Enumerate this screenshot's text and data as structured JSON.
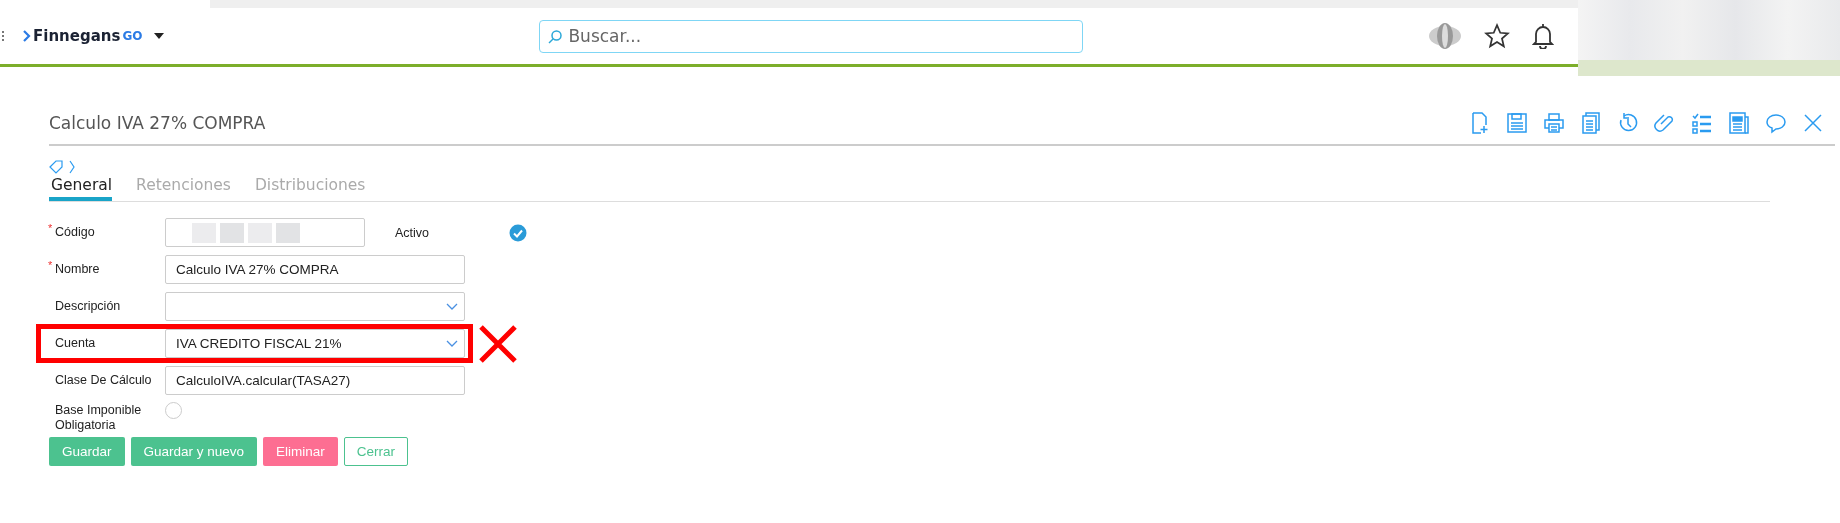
{
  "header": {
    "logo": {
      "name": "Finnegans",
      "suffix": "GO"
    },
    "search": {
      "placeholder": "Buscar..."
    }
  },
  "form": {
    "title": "Calculo IVA 27% COMPRA",
    "tabs": [
      {
        "label": "General",
        "selected": true
      },
      {
        "label": "Retenciones",
        "selected": false
      },
      {
        "label": "Distribuciones",
        "selected": false
      }
    ],
    "fields": [
      {
        "kind": "text",
        "label": "Código",
        "required_mark": "*",
        "blurred": true,
        "annotated": false,
        "side": {
          "label": "Activo",
          "checked": true
        }
      },
      {
        "kind": "text",
        "label": "Nombre",
        "required_mark": "*",
        "value": "Calculo IVA 27% COMPRA",
        "annotated": false
      },
      {
        "kind": "select",
        "label": "Descripción",
        "annotated": false
      },
      {
        "kind": "select",
        "label": "Cuenta",
        "value": "IVA CREDITO FISCAL 21%",
        "annotated": true
      },
      {
        "kind": "text",
        "label": "Clase De Cálculo",
        "value": "CalculoIVA.calcular(TASA27)",
        "annotated": false
      },
      {
        "kind": "radio",
        "label": "Base Imponible Obligatoria",
        "checked": false,
        "annotated": false
      }
    ],
    "buttons": [
      {
        "label": "Guardar",
        "kind": "primary"
      },
      {
        "label": "Guardar y nuevo",
        "kind": "primary"
      },
      {
        "label": "Eliminar",
        "kind": "danger"
      },
      {
        "label": "Cerrar",
        "kind": "outline"
      }
    ]
  }
}
